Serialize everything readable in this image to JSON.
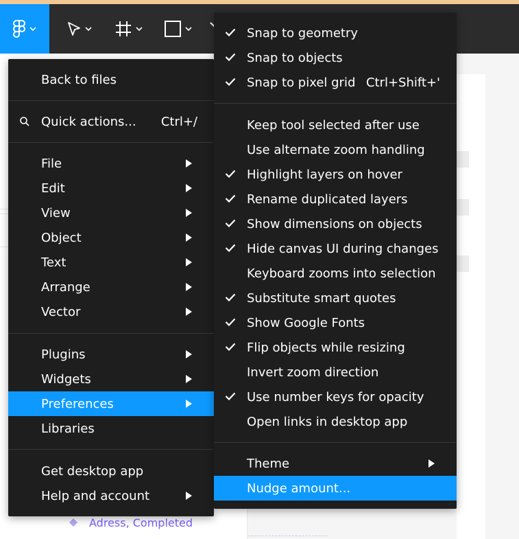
{
  "toolbar": {
    "main_icon": "figma-logo-icon",
    "tools": [
      "figma-logo-icon",
      "move-tool-icon",
      "frame-tool-icon",
      "rectangle-tool-icon",
      "pen-tool-icon"
    ]
  },
  "colors": {
    "accent": "#0d99ff",
    "menu_bg": "#1e1e1e",
    "toolbar_bg": "#2c2c2c",
    "layer_purple": "#7b61ff"
  },
  "layers": {
    "visible_item": "Adress, Completed"
  },
  "main_menu": {
    "back_to_files": "Back to files",
    "quick_actions": "Quick actions...",
    "quick_actions_shortcut": "Ctrl+/",
    "file": "File",
    "edit": "Edit",
    "view": "View",
    "object": "Object",
    "text": "Text",
    "arrange": "Arrange",
    "vector": "Vector",
    "plugins": "Plugins",
    "widgets": "Widgets",
    "preferences": "Preferences",
    "libraries": "Libraries",
    "get_desktop_app": "Get desktop app",
    "help_and_account": "Help and account"
  },
  "preferences_menu": {
    "snap_to_geometry": "Snap to geometry",
    "snap_to_objects": "Snap to objects",
    "snap_to_pixel_grid": "Snap to pixel grid",
    "snap_to_pixel_grid_shortcut": "Ctrl+Shift+'",
    "keep_tool_selected": "Keep tool selected after use",
    "alternate_zoom": "Use alternate zoom handling",
    "highlight_layers": "Highlight layers on hover",
    "rename_duplicated": "Rename duplicated layers",
    "show_dimensions": "Show dimensions on objects",
    "hide_canvas_ui": "Hide canvas UI during changes",
    "keyboard_zooms": "Keyboard zooms into selection",
    "smart_quotes": "Substitute smart quotes",
    "google_fonts": "Show Google Fonts",
    "flip_objects": "Flip objects while resizing",
    "invert_zoom": "Invert zoom direction",
    "number_keys_opacity": "Use number keys for opacity",
    "open_links_desktop": "Open links in desktop app",
    "theme": "Theme",
    "nudge_amount": "Nudge amount..."
  }
}
